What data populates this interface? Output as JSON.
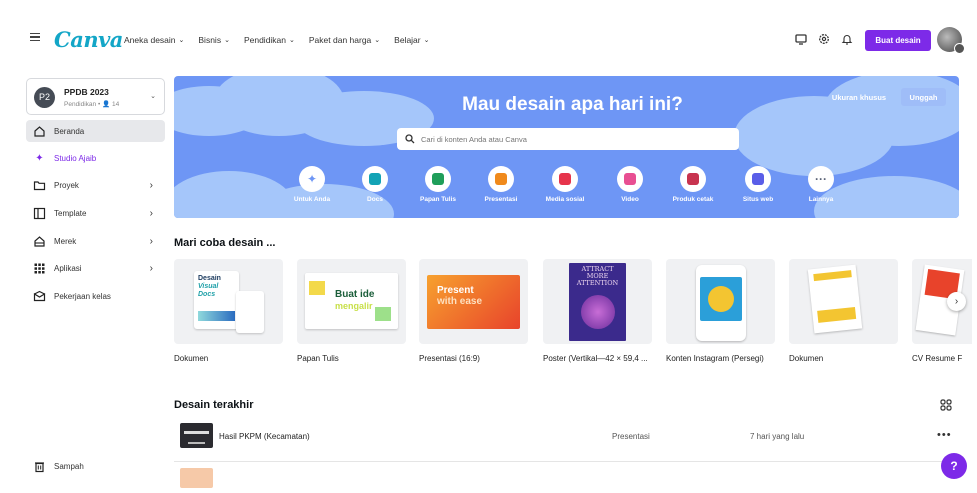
{
  "header": {
    "logo": "Canva",
    "nav": [
      {
        "label": "Aneka desain"
      },
      {
        "label": "Bisnis"
      },
      {
        "label": "Pendidikan"
      },
      {
        "label": "Paket dan harga"
      },
      {
        "label": "Belajar"
      }
    ],
    "create_button": "Buat desain",
    "icons": [
      "monitor-icon",
      "gear-icon",
      "bell-icon"
    ]
  },
  "sidebar": {
    "team": {
      "initials": "P2",
      "name": "PPDB 2023",
      "sub": "Pendidikan • 👤 14"
    },
    "items": [
      {
        "label": "Beranda",
        "icon": "home-icon",
        "active": true
      },
      {
        "label": "Studio Ajaib",
        "icon": "sparkle-icon"
      },
      {
        "label": "Proyek",
        "icon": "folder-icon"
      },
      {
        "label": "Template",
        "icon": "template-icon"
      },
      {
        "label": "Merek",
        "icon": "brand-icon"
      },
      {
        "label": "Aplikasi",
        "icon": "apps-icon"
      },
      {
        "label": "Pekerjaan kelas",
        "icon": "class-icon"
      }
    ],
    "trash": "Sampah"
  },
  "hero": {
    "title": "Mau desain apa hari ini?",
    "custom_size": "Ukuran khusus",
    "upload": "Unggah",
    "search_placeholder": "Cari di konten Anda atau Canva",
    "categories": [
      {
        "label": "Untuk Anda",
        "icon": "sparkle-icon",
        "color": "#6e96f5"
      },
      {
        "label": "Docs",
        "icon": "docs-icon",
        "color": "#13a3b5"
      },
      {
        "label": "Papan Tulis",
        "icon": "whiteboard-icon",
        "color": "#1f9e5a"
      },
      {
        "label": "Presentasi",
        "icon": "presentation-icon",
        "color": "#f08a1c"
      },
      {
        "label": "Media sosial",
        "icon": "heart-icon",
        "color": "#e6344b"
      },
      {
        "label": "Video",
        "icon": "video-icon",
        "color": "#e84f92"
      },
      {
        "label": "Produk cetak",
        "icon": "print-icon",
        "color": "#c8344f"
      },
      {
        "label": "Situs web",
        "icon": "website-icon",
        "color": "#5a5ee8"
      },
      {
        "label": "Lainnya",
        "icon": "more-icon",
        "color": "#5a6276"
      }
    ]
  },
  "try_section": {
    "title": "Mari coba desain ...",
    "templates": [
      {
        "label": "Dokumen",
        "texts": [
          "Desain",
          "Visual Docs"
        ]
      },
      {
        "label": "Papan Tulis",
        "texts": [
          "Buat ide",
          "mengalir"
        ]
      },
      {
        "label": "Presentasi (16:9)",
        "texts": [
          "Present",
          "with ease"
        ]
      },
      {
        "label": "Poster (Vertikal—42 × 59,4 ...",
        "texts": [
          "ATTRACT MORE ATTENTION"
        ]
      },
      {
        "label": "Konten Instagram (Persegi)",
        "texts": []
      },
      {
        "label": "Dokumen",
        "texts": []
      },
      {
        "label": "CV Resume F",
        "texts": []
      }
    ]
  },
  "recent": {
    "title": "Desain terakhir",
    "rows": [
      {
        "name": "Hasil PKPM (Kecamatan)",
        "type": "Presentasi",
        "time": "7 hari yang lalu"
      }
    ]
  },
  "help": "?"
}
